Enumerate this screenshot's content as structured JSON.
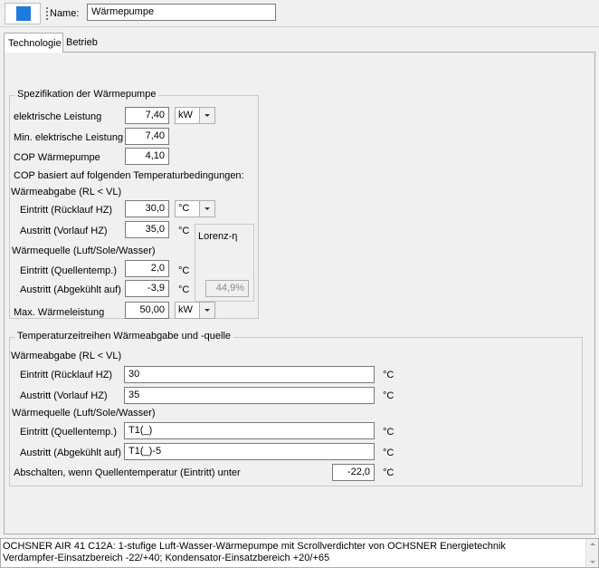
{
  "header": {
    "color": "#1e7bd9",
    "name_label": "Name:",
    "name_value": "Wärmepumpe"
  },
  "tabs": [
    {
      "label": "Technologie",
      "active": true
    },
    {
      "label": "Betrieb",
      "active": false
    }
  ],
  "spec": {
    "title": "Spezifikation der Wärmepumpe",
    "el_power_label": "elektrische Leistung",
    "el_power_value": "7,40",
    "el_power_unit": "kW",
    "min_el_power_label": "Min. elektrische Leistung",
    "min_el_power_value": "7,40",
    "cop_label": "COP Wärmepumpe",
    "cop_value": "4,10",
    "cop_basis": "COP basiert auf folgenden Temperaturbedingungen:",
    "output_heading": "Wärmeabgabe (RL < VL)",
    "inlet_label": "Eintritt (Rücklauf HZ)",
    "inlet_value": "30,0",
    "inlet_unit": "°C",
    "outlet_label": "Austritt (Vorlauf HZ)",
    "outlet_value": "35,0",
    "outlet_unit": "°C",
    "lorenz_label": "Lorenz-η",
    "lorenz_value": "44,9%",
    "source_heading": "Wärmequelle (Luft/Sole/Wasser)",
    "src_inlet_label": "Eintritt (Quellentemp.)",
    "src_inlet_value": "2,0",
    "src_inlet_unit": "°C",
    "src_outlet_label": "Austritt (Abgekühlt auf)",
    "src_outlet_value": "-3,9",
    "src_outlet_unit": "°C",
    "max_heat_label": "Max. Wärmeleistung",
    "max_heat_value": "50,00",
    "max_heat_unit": "kW"
  },
  "series": {
    "title": "Temperaturzeitreihen Wärmeabgabe und -quelle",
    "output_heading": "Wärmeabgabe (RL < VL)",
    "inlet_label": "Eintritt (Rücklauf HZ)",
    "inlet_value": "30",
    "inlet_unit": "°C",
    "outlet_label": "Austritt (Vorlauf HZ)",
    "outlet_value": "35",
    "outlet_unit": "°C",
    "source_heading": "Wärmequelle (Luft/Sole/Wasser)",
    "src_inlet_label": "Eintritt (Quellentemp.)",
    "src_inlet_value": "T1(_)",
    "src_inlet_unit": "°C",
    "src_outlet_label": "Austritt (Abgekühlt auf)",
    "src_outlet_value": "T1(_)-5",
    "src_outlet_unit": "°C",
    "shutdown_label": "Abschalten, wenn Quellentemperatur (Eintritt) unter",
    "shutdown_value": "-22,0",
    "shutdown_unit": "°C"
  },
  "description": {
    "line1": "OCHSNER AIR 41 C12A: 1-stufige Luft-Wasser-Wärmepumpe mit Scrollverdichter von OCHSNER Energietechnik",
    "line2": "Verdampfer-Einsatzbereich -22/+40; Kondensator-Einsatzbereich +20/+65"
  }
}
